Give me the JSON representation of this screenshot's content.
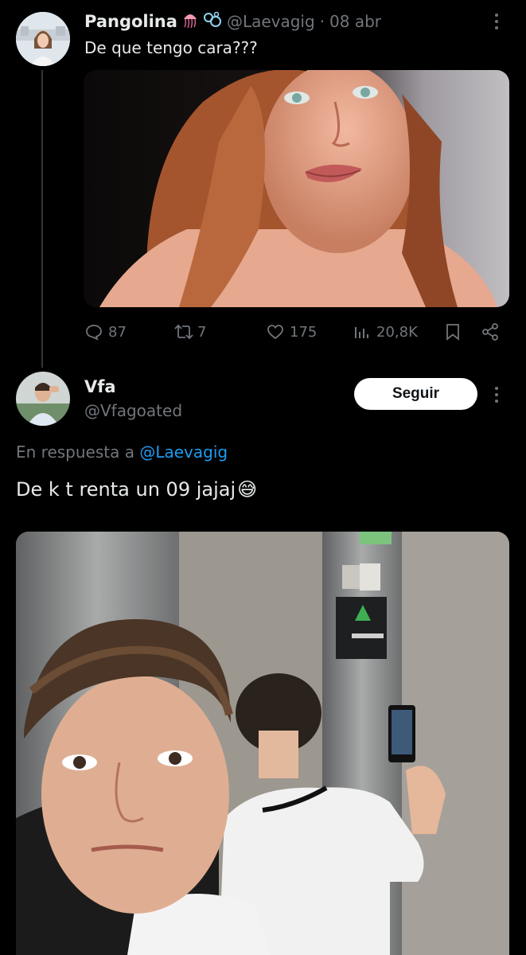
{
  "tweet1": {
    "name": "Pangolina",
    "handle": "@Laevagig",
    "separator": "·",
    "date": "08 abr",
    "text": "De que tengo cara???",
    "actions": {
      "replies": "87",
      "retweets": "7",
      "likes": "175",
      "views": "20,8K"
    }
  },
  "tweet2": {
    "name": "Vfa",
    "handle": "@Vfagoated",
    "follow_label": "Seguir",
    "reply_prefix": "En respuesta a",
    "reply_to": "@Laevagig",
    "text": "De k t renta un 09 jajaj",
    "emoji": "😅"
  },
  "colors": {
    "background": "#000000",
    "text": "#e7e9ea",
    "muted": "#71767b",
    "link": "#1d9bf0"
  }
}
